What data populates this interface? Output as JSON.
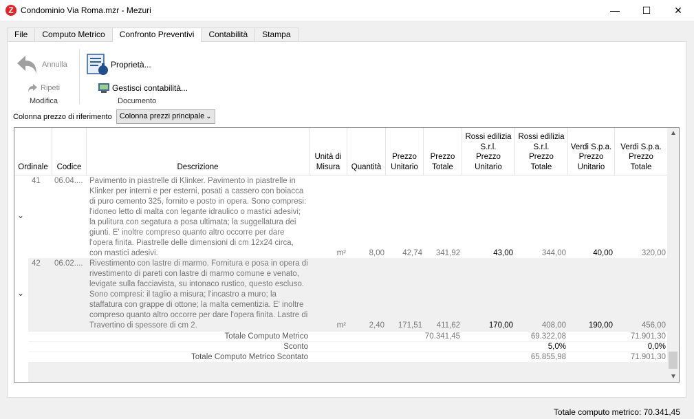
{
  "window": {
    "title": "Condominio Via Roma.mzr - Mezuri",
    "app_icon_letter": "Z"
  },
  "tabs": [
    "File",
    "Computo Metrico",
    "Confronto Preventivi",
    "Contabilità",
    "Stampa"
  ],
  "active_tab": "Confronto Preventivi",
  "ribbon": {
    "undo": "Annulla",
    "redo": "Ripeti",
    "group_modifica": "Modifica",
    "properties": "Proprietà...",
    "manage_accounting": "Gestisci contabilità...",
    "group_documento": "Documento"
  },
  "reference": {
    "label": "Colonna prezzo di riferimento",
    "value": "Colonna prezzi principale"
  },
  "columns": {
    "ordinale": "Ordinale",
    "codice": "Codice",
    "descrizione": "Descrizione",
    "unita_1": "Unità di",
    "unita_2": "Misura",
    "quantita": "Quantità",
    "pu_1": "Prezzo",
    "pu_2": "Unitario",
    "pt_1": "Prezzo",
    "pt_2": "Totale",
    "rossi_pu_1": "Rossi edilizia",
    "rossi_pu_2": "S.r.l.",
    "rossi_pu_3": "Prezzo",
    "rossi_pu_4": "Unitario",
    "rossi_pt_1": "Rossi edilizia",
    "rossi_pt_2": "S.r.l.",
    "rossi_pt_3": "Prezzo",
    "rossi_pt_4": "Totale",
    "verdi_pu_1": "Verdi S.p.a.",
    "verdi_pu_2": "Prezzo",
    "verdi_pu_3": "Unitario",
    "verdi_pt_1": "Verdi S.p.a.",
    "verdi_pt_2": "Prezzo",
    "verdi_pt_3": "Totale"
  },
  "rows": [
    {
      "ordinale": "41",
      "codice": "06.04....",
      "descrizione": "Pavimento in piastrelle di Klinker. Pavimento in piastrelle in Klinker per interni e per esterni, posati a cassero con boiacca di puro cemento 325, fornito e posto in opera. Sono compresi: l'idoneo letto di malta con legante idraulico o mastici adesivi; la pulitura con segatura a posa ultimata; la suggellatura dei giunti. E' inoltre compreso quanto altro occorre per dare l'opera finita. Piastrelle delle dimensioni di cm 12x24 circa, con mastici adesivi.",
      "unita": "m²",
      "quantita": "8,00",
      "prezzo_unitario": "42,74",
      "prezzo_totale": "341,92",
      "rossi_pu": "43,00",
      "rossi_pt": "344,00",
      "verdi_pu": "40,00",
      "verdi_pt": "320,00"
    },
    {
      "ordinale": "42",
      "codice": "06.02....",
      "descrizione": "Rivestimento con lastre di marmo. Fornitura e posa in opera di rivestimento di pareti con lastre di marmo comune e venato, levigate sulla facciavista, su intonaco rustico, questo escluso. Sono compresi: il taglio a misura; l'incastro a muro; la staffatura con grappe di ottone; la malta cementizia. E' inoltre compreso quanto altro occorre per dare l'opera finita. Lastre di Travertino di spessore di cm 2.",
      "unita": "m²",
      "quantita": "2,40",
      "prezzo_unitario": "171,51",
      "prezzo_totale": "411,62",
      "rossi_pu": "170,00",
      "rossi_pt": "408,00",
      "verdi_pu": "190,00",
      "verdi_pt": "456,00"
    }
  ],
  "totals": {
    "totale_label": "Totale Computo Metrico",
    "totale_main": "70.341,45",
    "totale_rossi": "69.322,08",
    "totale_verdi": "71.901,30",
    "sconto_label": "Sconto",
    "sconto_rossi": "5,0%",
    "sconto_verdi": "0,0%",
    "scontato_label": "Totale Computo Metrico Scontato",
    "scontato_rossi": "65.855,98",
    "scontato_verdi": "71.901,30"
  },
  "status_bar": "Totale computo metrico: 70.341,45"
}
